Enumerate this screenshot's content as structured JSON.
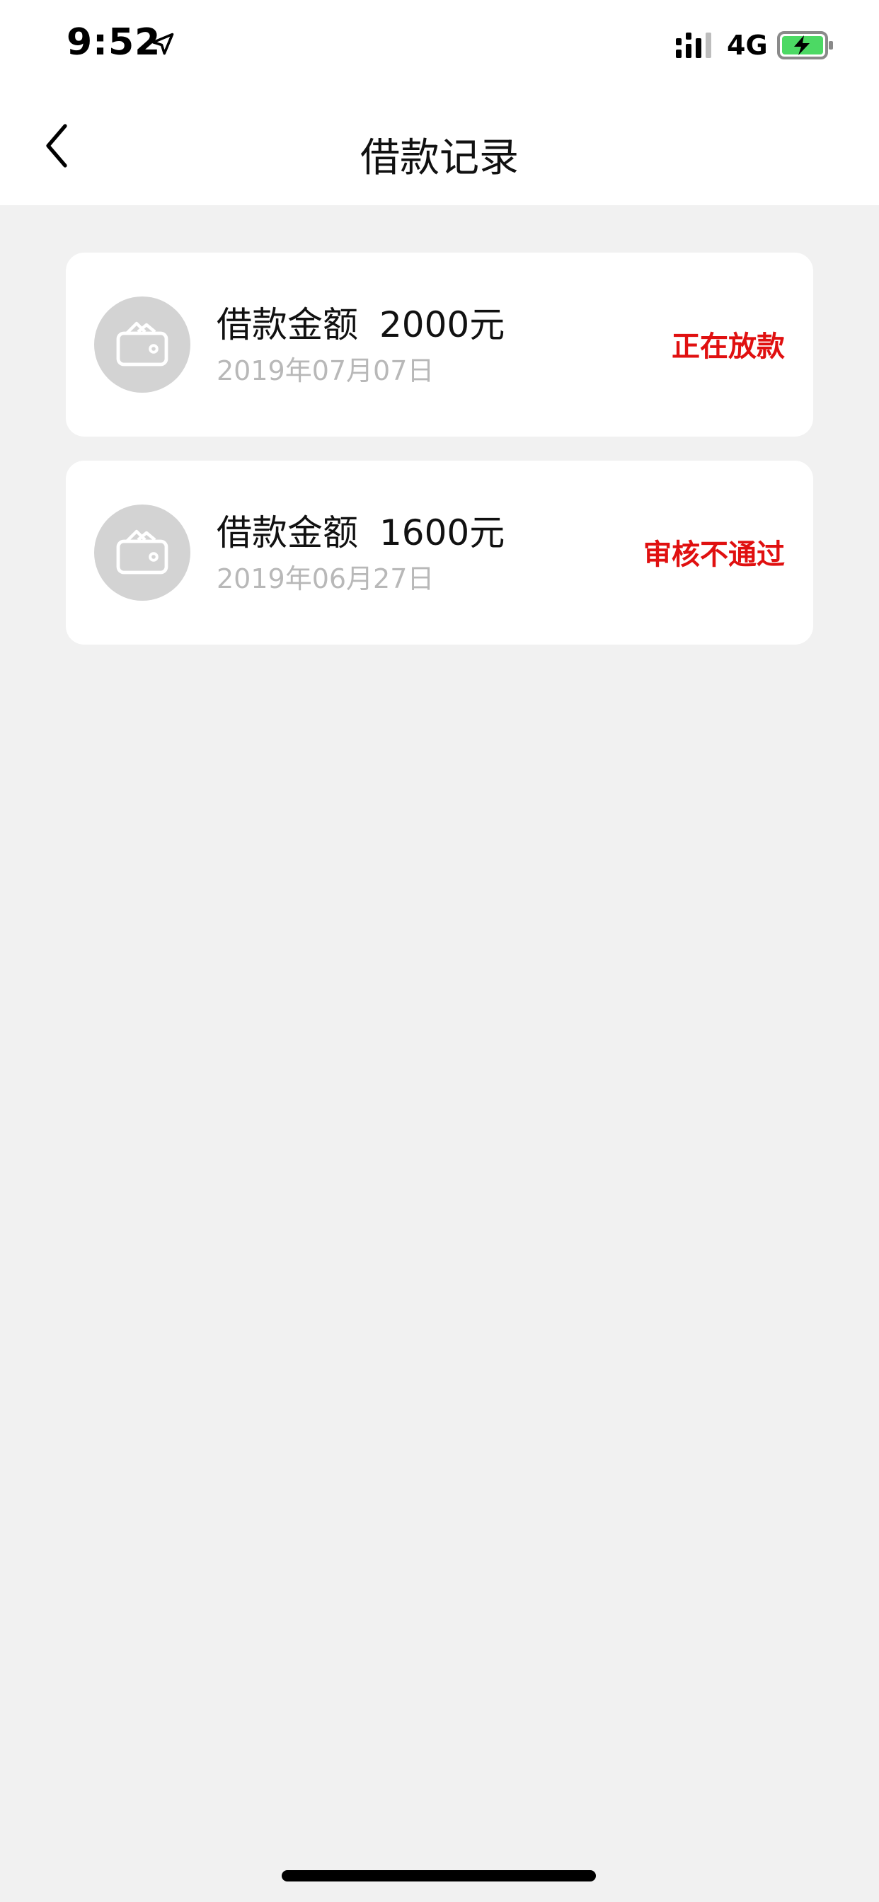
{
  "status_bar": {
    "time": "9:52",
    "network": "4G",
    "icons": [
      "location-arrow-icon",
      "signal-icon",
      "battery-charging-icon"
    ]
  },
  "header": {
    "title": "借款记录",
    "back_icon": "chevron-left-icon"
  },
  "records": [
    {
      "amount_label": "借款金额",
      "amount": "2000元",
      "date": "2019年07月07日",
      "status": "正在放款",
      "icon": "wallet-icon"
    },
    {
      "amount_label": "借款金额",
      "amount": "1600元",
      "date": "2019年06月27日",
      "status": "审核不通过",
      "icon": "wallet-icon"
    }
  ],
  "colors": {
    "background": "#f1f1f1",
    "card": "#ffffff",
    "status_red": "#e01010",
    "date_gray": "#b8b8b8",
    "avatar_gray": "#d3d3d3"
  }
}
